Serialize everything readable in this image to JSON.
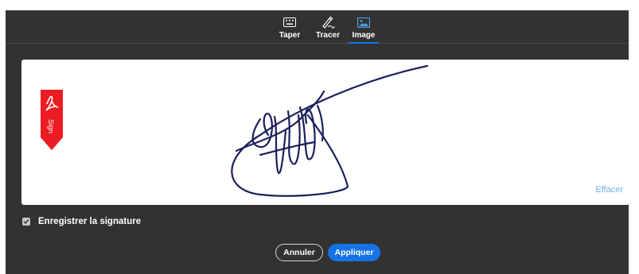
{
  "tabs": [
    {
      "label": "Taper",
      "icon": "keyboard-icon",
      "active": false
    },
    {
      "label": "Tracer",
      "icon": "pen-draw-icon",
      "active": false
    },
    {
      "label": "Image",
      "icon": "image-icon",
      "active": true
    }
  ],
  "canvas": {
    "badge_text": "Sign",
    "clear_label": "Effacer"
  },
  "save_signature": {
    "label": "Enregistrer la signature",
    "checked": true
  },
  "buttons": {
    "cancel_label": "Annuler",
    "apply_label": "Appliquer"
  },
  "colors": {
    "dialog_bg": "#323232",
    "accent": "#1473e6",
    "clear_link": "#6fb3e6",
    "badge_red": "#eb1c24",
    "ink": "#1a1f5c"
  }
}
